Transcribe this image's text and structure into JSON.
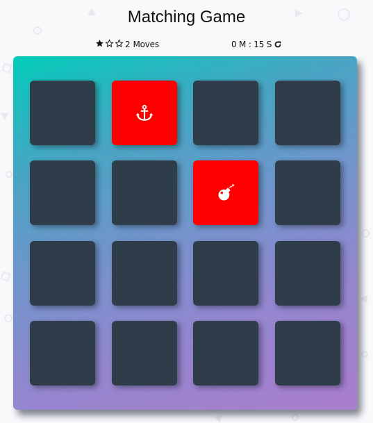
{
  "title": "Matching Game",
  "score": {
    "stars": [
      "filled",
      "empty",
      "empty"
    ],
    "moves_count": "2",
    "moves_label": "Moves",
    "timer_text": "0 M : 15 S",
    "restart_icon": "rotate-right-icon"
  },
  "deck": {
    "cards": [
      {
        "state": "closed",
        "icon": ""
      },
      {
        "state": "open",
        "icon": "anchor-icon"
      },
      {
        "state": "closed",
        "icon": ""
      },
      {
        "state": "closed",
        "icon": ""
      },
      {
        "state": "closed",
        "icon": ""
      },
      {
        "state": "closed",
        "icon": ""
      },
      {
        "state": "open",
        "icon": "bomb-icon"
      },
      {
        "state": "closed",
        "icon": ""
      },
      {
        "state": "closed",
        "icon": ""
      },
      {
        "state": "closed",
        "icon": ""
      },
      {
        "state": "closed",
        "icon": ""
      },
      {
        "state": "closed",
        "icon": ""
      },
      {
        "state": "closed",
        "icon": ""
      },
      {
        "state": "closed",
        "icon": ""
      },
      {
        "state": "closed",
        "icon": ""
      },
      {
        "state": "closed",
        "icon": ""
      }
    ]
  },
  "colors": {
    "card_closed": "#2e3d49",
    "card_open": "#ff0000",
    "deck_gradient_start": "#02ccba",
    "deck_gradient_end": "#aa7ecd"
  }
}
